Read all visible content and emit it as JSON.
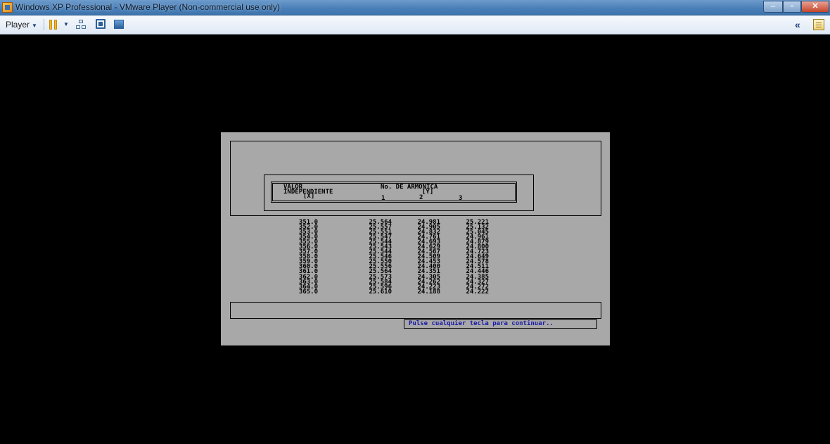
{
  "window": {
    "title": "Windows XP Professional - VMware Player (Non-commercial use only)",
    "minimize_glyph": "–",
    "maximize_glyph": "▫",
    "close_glyph": "✕"
  },
  "toolbar": {
    "player_label": "Player",
    "player_caret": "▼",
    "pause_caret": "▼",
    "collapse_glyph": "«",
    "icons": [
      "pause-icon",
      "network-icon",
      "fullscreen-icon",
      "unity-icon",
      "collapse-icon",
      "library-icon"
    ]
  },
  "dos": {
    "header": {
      "valor": "VALOR",
      "independiente": "INDEPENDIENTE",
      "x_label": "[X]",
      "armonica": "No. DE ARMONICA",
      "y_label": "[Y]",
      "h1": "1",
      "h2": "2",
      "h3": "3"
    },
    "columns": {
      "x": [
        "351.0",
        "352.0",
        "353.0",
        "354.0",
        "355.0",
        "356.0",
        "357.0",
        "358.0",
        "359.0",
        "360.0",
        "361.0",
        "362.0",
        "363.0",
        "364.0",
        "365.0"
      ],
      "h1": [
        "25.564",
        "25.557",
        "25.551",
        "25.547",
        "25.544",
        "25.543",
        "25.544",
        "25.546",
        "25.550",
        "25.556",
        "25.564",
        "25.573",
        "25.584",
        "25.596",
        "25.610"
      ],
      "h2": [
        "24.981",
        "24.905",
        "24.832",
        "24.761",
        "24.693",
        "24.629",
        "24.567",
        "24.509",
        "24.453",
        "24.400",
        "24.351",
        "24.305",
        "24.262",
        "24.223",
        "24.188"
      ],
      "h3": [
        "25.221",
        "25.132",
        "25.045",
        "24.961",
        "24.879",
        "24.800",
        "24.723",
        "24.649",
        "24.578",
        "24.511",
        "24.446",
        "24.385",
        "24.327",
        "24.272",
        "24.222"
      ]
    },
    "prompt": "Pulse cualquier tecla para continuar.."
  },
  "colors": {
    "dos_background": "#a8a8a8",
    "prompt_text": "#1a1aa8",
    "vm_background": "#000000"
  }
}
